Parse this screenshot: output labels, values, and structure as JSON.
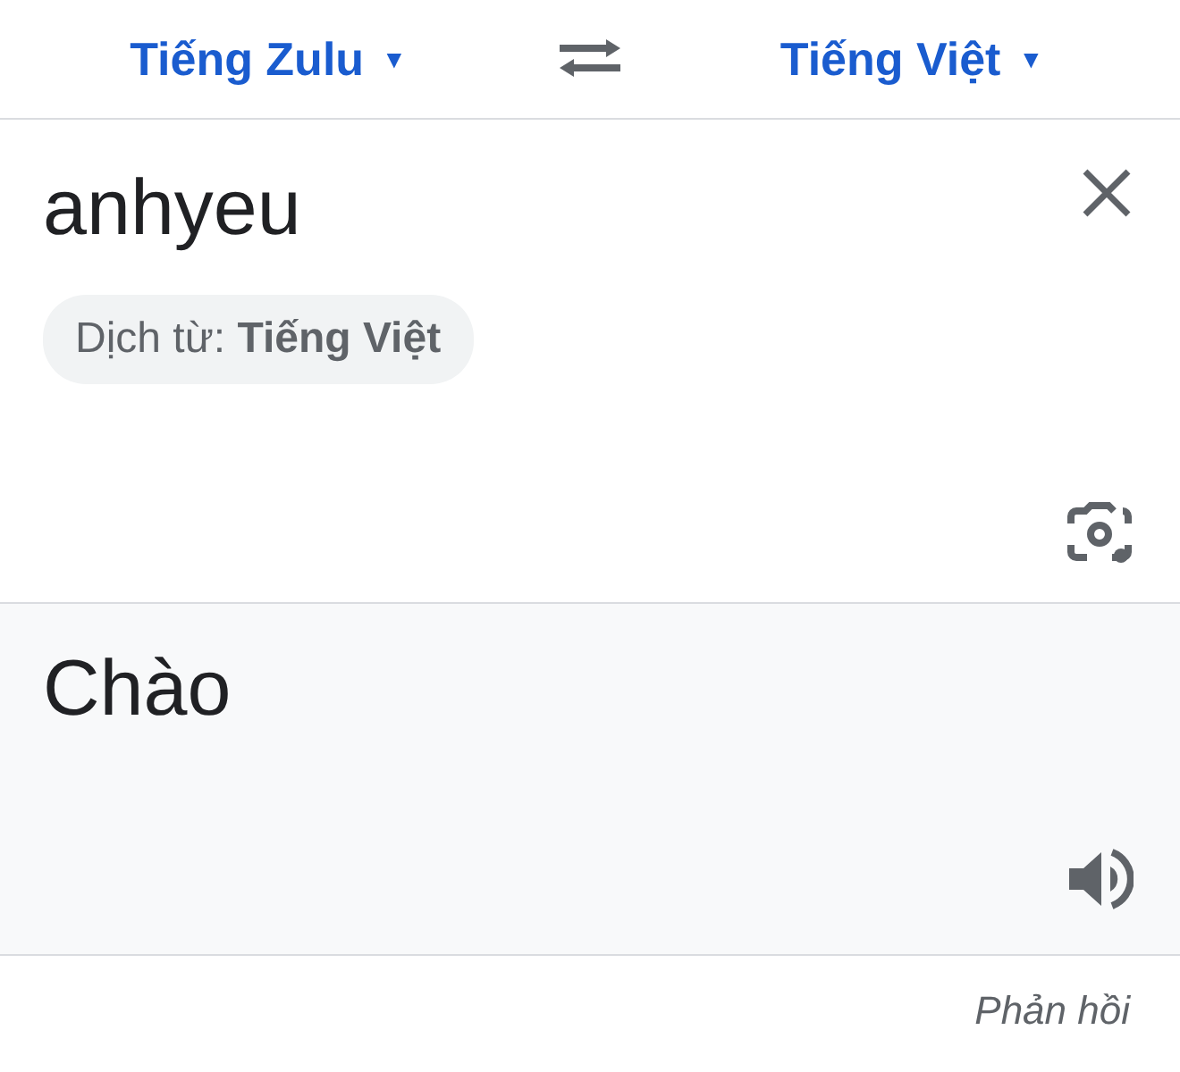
{
  "language_bar": {
    "source": {
      "label": "Tiếng Zulu",
      "caret": "▼"
    },
    "target": {
      "label": "Tiếng Việt",
      "caret": "▼"
    }
  },
  "input": {
    "value": "anhyeu",
    "detected_chip": "Dịch từ: **Tiếng Việt**"
  },
  "output": {
    "text": "Chào"
  },
  "feedback_link": "Phản hồi"
}
